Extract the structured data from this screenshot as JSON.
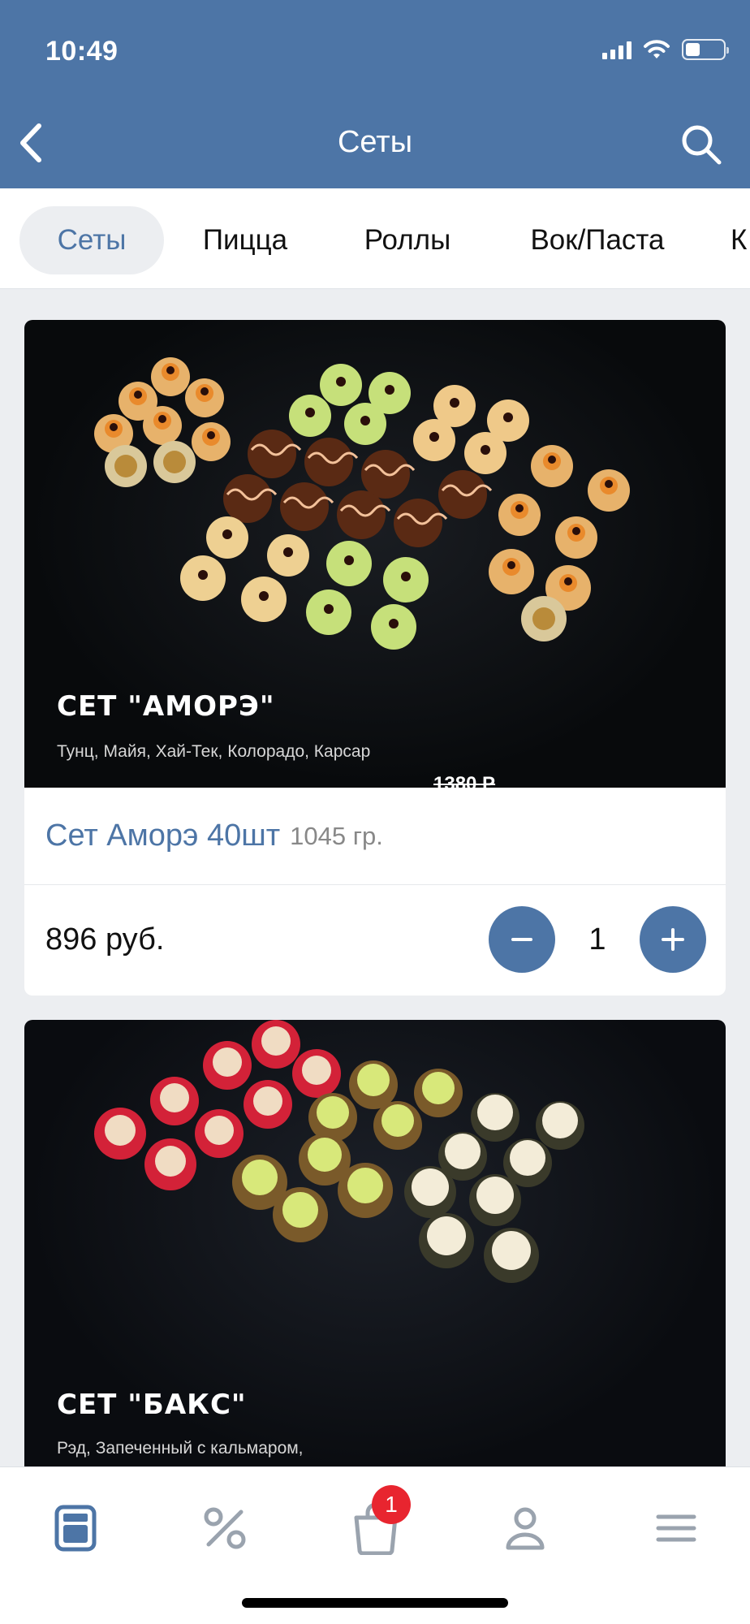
{
  "status": {
    "time": "10:49"
  },
  "header": {
    "title": "Сеты"
  },
  "tabs": [
    {
      "label": "Сеты"
    },
    {
      "label": "Пицца"
    },
    {
      "label": "Роллы"
    },
    {
      "label": "Вок/Паста"
    }
  ],
  "products": [
    {
      "image_title": "СЕТ \"АМОРЭ\"",
      "image_desc": "Тунц, Майя, Хай-Тек, Колорадо, Карсар",
      "image_old_price": "1380 Р",
      "name": "Сет Аморэ 40шт",
      "weight": "1045 гр.",
      "price": "896 руб.",
      "quantity": "1"
    },
    {
      "image_title": "СЕТ \"БАКС\"",
      "image_desc": "Рэд, Запеченный с кальмаром,"
    }
  ],
  "bottom_nav": {
    "items": [
      {
        "icon": "menu-book-icon"
      },
      {
        "icon": "percent-icon"
      },
      {
        "icon": "shopping-bag-icon",
        "badge": "1"
      },
      {
        "icon": "profile-icon"
      },
      {
        "icon": "hamburger-menu-icon"
      }
    ]
  },
  "colors": {
    "primary": "#4d75a6",
    "badge": "#e8252f",
    "background": "#eceef1"
  }
}
